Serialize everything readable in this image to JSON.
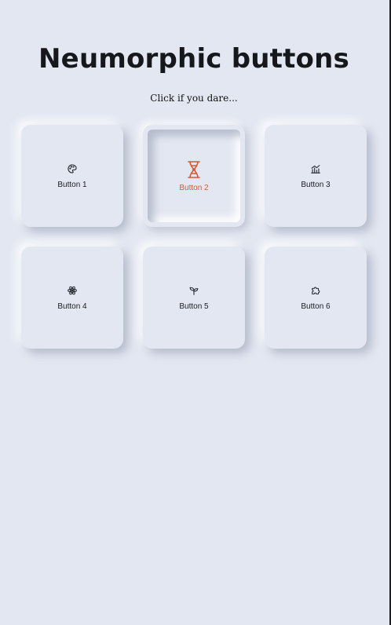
{
  "page": {
    "title": "Neumorphic buttons",
    "subtitle": "Click if you dare..."
  },
  "buttons": [
    {
      "label": "Button 1",
      "icon": "palette-icon",
      "state": "normal"
    },
    {
      "label": "Button 2",
      "icon": "dna-icon",
      "state": "pressed"
    },
    {
      "label": "Button 3",
      "icon": "chart-icon",
      "state": "normal"
    },
    {
      "label": "Button 4",
      "icon": "atom-icon",
      "state": "normal"
    },
    {
      "label": "Button 5",
      "icon": "sprout-icon",
      "state": "normal"
    },
    {
      "label": "Button 6",
      "icon": "puzzle-icon",
      "state": "normal"
    }
  ],
  "colors": {
    "background": "#e3e7f1",
    "accent": "#d35a35",
    "text": "#17181c"
  }
}
